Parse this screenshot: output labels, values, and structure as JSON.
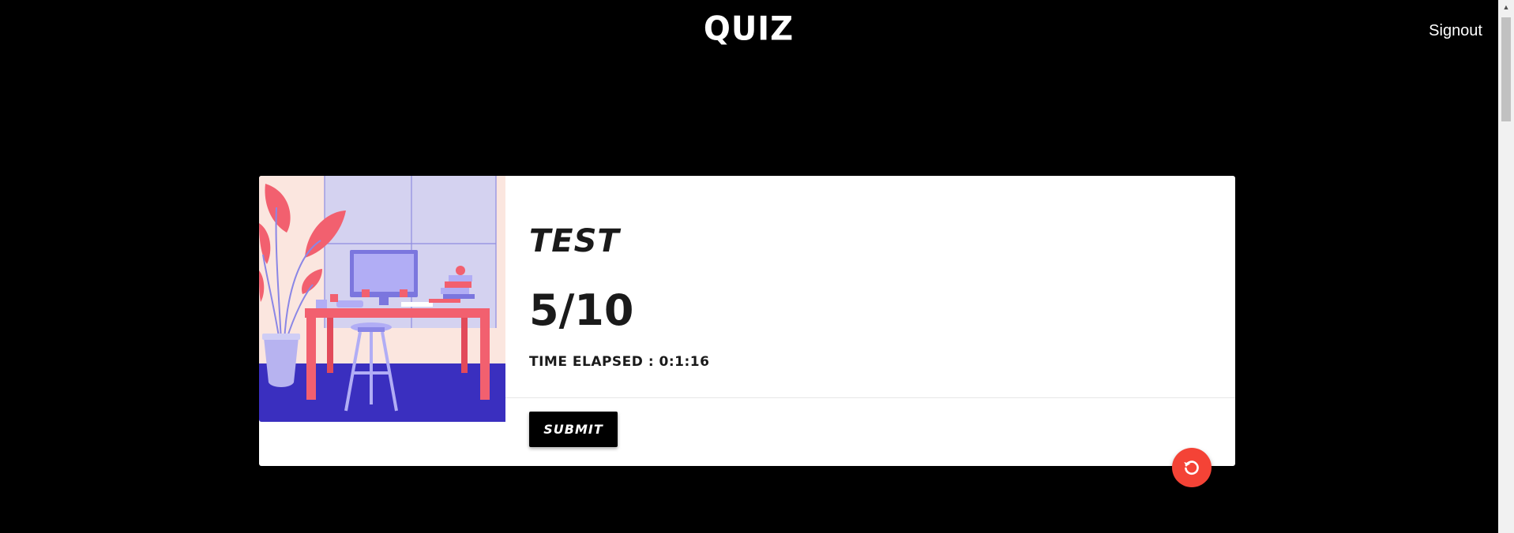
{
  "header": {
    "logo_text": "QUIZ",
    "signout_label": "Signout"
  },
  "quiz_card": {
    "illustration": "desk-workspace-illustration",
    "title": "TEST",
    "score": "5/10",
    "time_elapsed": "TIME ELAPSED : 0:1:16",
    "submit_label": "SUBMIT",
    "retry_icon": "refresh-icon"
  },
  "colors": {
    "background": "#000000",
    "card": "#ffffff",
    "fab": "#f44336",
    "illustration_floor": "#3a2fbf",
    "illustration_wall": "#fbe6df",
    "illustration_window": "#d4d2f0",
    "illustration_desk": "#f2606f"
  }
}
